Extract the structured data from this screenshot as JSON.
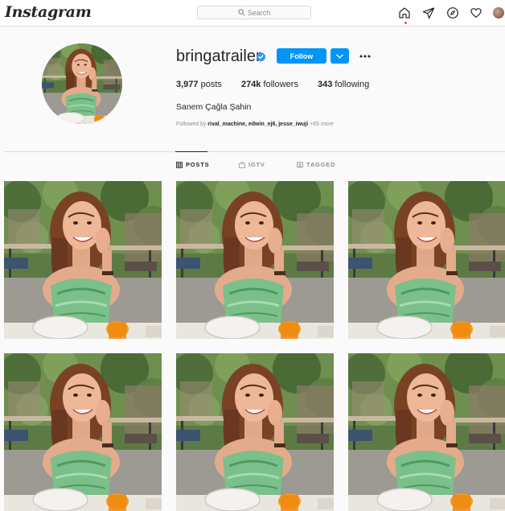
{
  "app": {
    "logo_text": "Instagram"
  },
  "search": {
    "placeholder": "Search",
    "icon": "search-icon"
  },
  "nav": {
    "icons": [
      "home-icon",
      "direct-icon",
      "explore-icon",
      "activity-heart-icon",
      "profile-avatar"
    ],
    "active": "home-icon"
  },
  "profile": {
    "username": "bringatrailer",
    "verified": true,
    "follow_label": "Follow",
    "stats": {
      "posts_count": "3,977",
      "posts_label": "posts",
      "followers_count": "274k",
      "followers_label": "followers",
      "following_count": "343",
      "following_label": "following"
    },
    "full_name": "Sanem Çağla Şahin",
    "followed_by": {
      "prefix": "Followed by ",
      "names": "rival_machine, edwin_ej6, jesse_iwuji",
      "suffix": " +65 more"
    }
  },
  "tabs": [
    {
      "label": "POSTS",
      "icon": "grid-icon",
      "active": true
    },
    {
      "label": "IGTV",
      "icon": "igtv-icon",
      "active": false
    },
    {
      "label": "TAGGED",
      "icon": "tagged-icon",
      "active": false
    }
  ],
  "colors": {
    "accent": "#0095f6",
    "verified": "#3897f0",
    "notification": "#ed4956"
  },
  "posts": [
    {
      "image": "woman in green top at cafe table"
    },
    {
      "image": "woman in green top at cafe table"
    },
    {
      "image": "woman in green top at cafe table"
    },
    {
      "image": "woman in green top at cafe table"
    },
    {
      "image": "woman in green top at cafe table"
    },
    {
      "image": "woman in green top at cafe table"
    }
  ]
}
